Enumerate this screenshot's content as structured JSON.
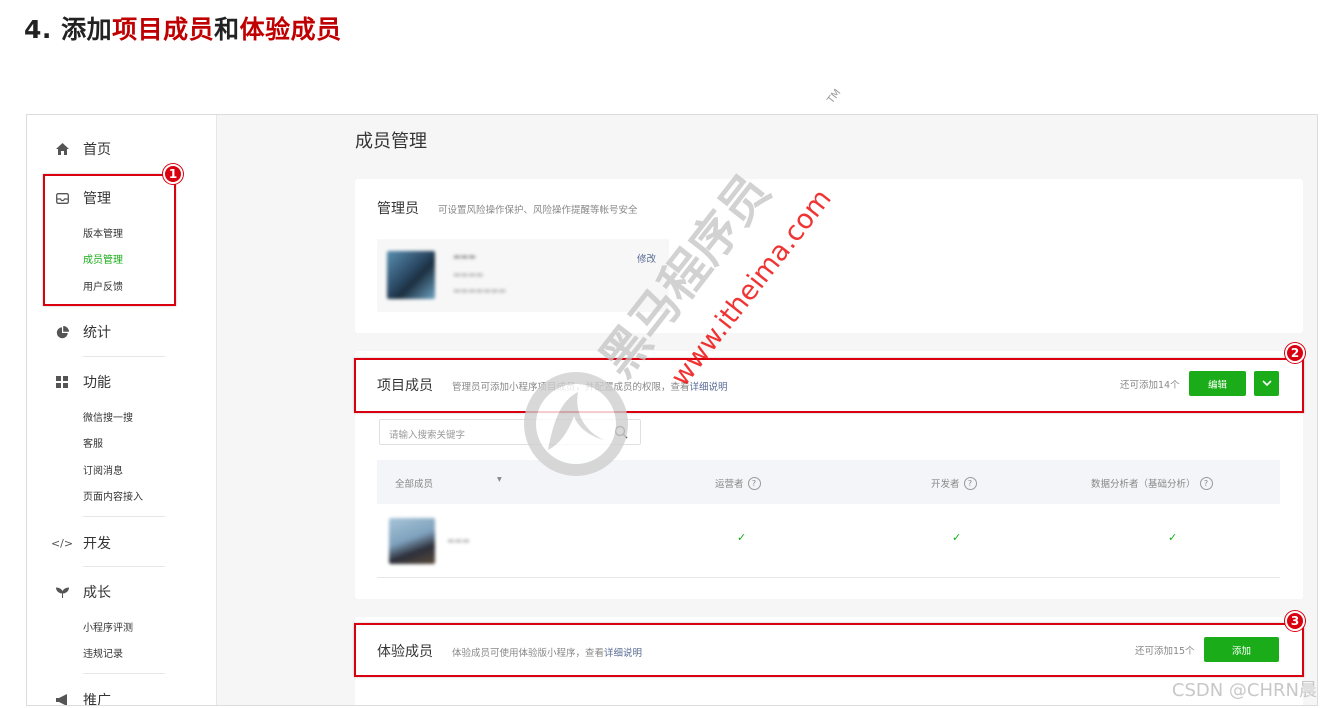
{
  "heading": {
    "prefix": "4. 添加",
    "part1": "项目成员",
    "mid": "和",
    "part2": "体验成员"
  },
  "sidebar": {
    "home": "首页",
    "manage": {
      "label": "管理",
      "items": [
        "版本管理",
        "成员管理",
        "用户反馈"
      ]
    },
    "stats": "统计",
    "features": {
      "label": "功能",
      "items": [
        "微信搜一搜",
        "客服",
        "订阅消息",
        "页面内容接入"
      ]
    },
    "develop": "开发",
    "growth": {
      "label": "成长",
      "items": [
        "小程序评测",
        "违规记录"
      ]
    },
    "promote": "推广"
  },
  "main": {
    "title": "成员管理",
    "admin": {
      "title": "管理员",
      "desc": "可设置风险操作保护、风险操作提醒等帐号安全",
      "edit": "修改"
    },
    "project": {
      "title": "项目成员",
      "desc": "管理员可添加小程序项目成员，并配置成员的权限，查看",
      "link": "详细说明",
      "remaining": "还可添加14个",
      "edit_btn": "编辑",
      "search_placeholder": "请输入搜索关键字",
      "columns": [
        "全部成员",
        "运营者",
        "开发者",
        "数据分析者（基础分析）"
      ],
      "row_checks": [
        "✓",
        "✓",
        "✓"
      ]
    },
    "trial": {
      "title": "体验成员",
      "desc": "体验成员可使用体验版小程序，查看",
      "link": "详细说明",
      "remaining": "还可添加15个",
      "add_btn": "添加"
    }
  },
  "badges": [
    "1",
    "2",
    "3"
  ],
  "watermark": {
    "brand": "黑马程序员",
    "tm": "TM",
    "site": "www.itheima.com"
  },
  "footer_mark": "CSDN @CHRN晨",
  "colors": {
    "accent_green": "#1aad19",
    "highlight_red": "#d9000f",
    "link_blue": "#576b95"
  }
}
